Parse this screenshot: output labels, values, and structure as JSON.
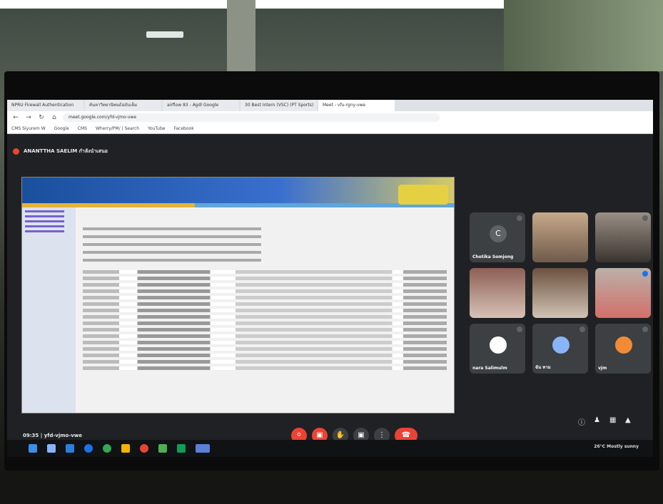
{
  "browser": {
    "tabs": [
      {
        "label": "NPRU Firewall Authentication"
      },
      {
        "label": "ค้นหาวิทยานิพนธ์ฉบับเต็ม"
      },
      {
        "label": "airflow 83 - Agdl Google"
      },
      {
        "label": "30 Best Intern (VSC) (PT Sports)"
      },
      {
        "label": "Meet - vfu-rgny-vwe"
      }
    ],
    "url": "meet.google.com/yfd-vjmo-vwe",
    "bookmarks": [
      {
        "label": "CMS Siyurem W"
      },
      {
        "label": "Google"
      },
      {
        "label": "CMS"
      },
      {
        "label": "Wherry/PM/ | Search"
      },
      {
        "label": "YouTube"
      },
      {
        "label": "Facebook"
      }
    ]
  },
  "meet": {
    "presenter": "ANANTTHA SAELIM กำลังนำเสนอ",
    "meeting_time": "09:35",
    "meeting_code": "yfd-vjmo-vwe",
    "participants": [
      {
        "name": "Chotika Somjong",
        "avatar": "C",
        "camera": false
      },
      {
        "name": "",
        "camera": true
      },
      {
        "name": "",
        "camera": true
      },
      {
        "name": "",
        "camera": true
      },
      {
        "name": "",
        "camera": true
      },
      {
        "name": "",
        "camera": true
      },
      {
        "name": "nara Salimulm",
        "avatar": "",
        "camera": false
      },
      {
        "name": "ฉัน ทาม",
        "avatar": "",
        "camera": false
      },
      {
        "name": "vjm",
        "avatar": "",
        "camera": false
      }
    ],
    "controls": {
      "mic_icon": "mic-off-icon",
      "cam_icon": "camera-off-icon",
      "raise_hand_icon": "raise-hand-icon",
      "present_icon": "present-icon",
      "more_icon": "more-icon",
      "end_icon": "end-call-icon"
    }
  },
  "taskbar": {
    "tray_text": "26°C  Mostly sunny"
  }
}
